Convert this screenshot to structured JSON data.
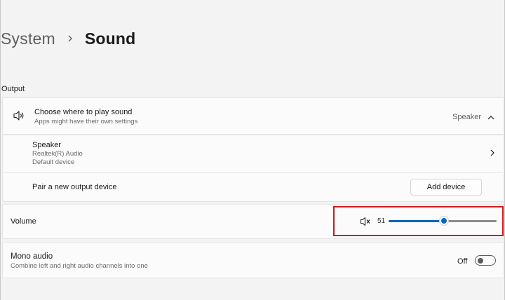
{
  "breadcrumb": {
    "parent": "System",
    "current": "Sound"
  },
  "output": {
    "section_label": "Output",
    "choose_title": "Choose where to play sound",
    "choose_subtitle": "Apps might have their own settings",
    "current_device": "Speaker",
    "speaker": {
      "name": "Speaker",
      "driver": "Realtek(R) Audio",
      "status": "Default device"
    },
    "pair_label": "Pair a new output device",
    "add_device_label": "Add device"
  },
  "volume": {
    "label": "Volume",
    "value": "51",
    "level_fraction": 0.51,
    "accent_color": "#0067c0",
    "highlight_color": "#d11a1a",
    "mute_icon": "volume-mute-icon"
  },
  "mono_audio": {
    "title": "Mono audio",
    "subtitle": "Combine left and right audio channels into one",
    "state": "Off"
  },
  "icons": {
    "speaker": "speaker-icon",
    "chevron_up": "chevron-up-icon",
    "chevron_right": "chevron-right-icon",
    "breadcrumb_separator": "chevron-right-icon"
  }
}
